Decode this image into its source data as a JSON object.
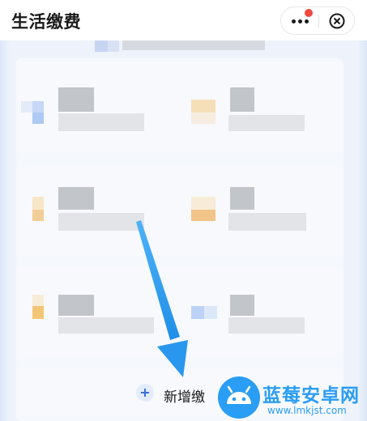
{
  "header": {
    "title": "生活缴费"
  },
  "menu_capsule": {
    "more_icon": "more-dots-icon",
    "notify_icon": "red-dot-badge",
    "close_icon": "close-circle-icon"
  },
  "actions": {
    "add_label": "新增缴",
    "add_icon": "plus-icon"
  },
  "watermark": {
    "title": "蓝莓安卓网",
    "url": "www.lmkjst.com",
    "logo_icon": "android-robot-icon"
  },
  "colors": {
    "accent_blue": "#2a9df4",
    "notify_red": "#f0493e"
  }
}
